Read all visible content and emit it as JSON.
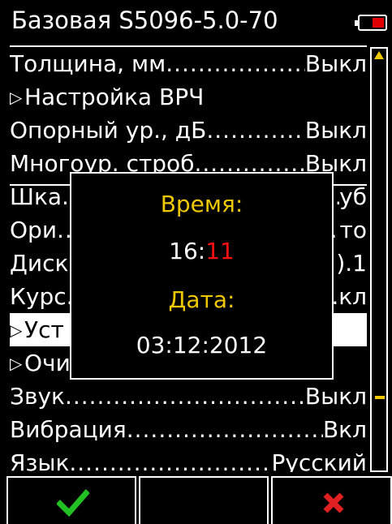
{
  "header": {
    "title": "Базовая S5096-5.0-70",
    "battery_icon": "battery-low-icon"
  },
  "menu": {
    "items": [
      {
        "label": "Толщина, мм",
        "value": "Выкл",
        "type": "value"
      },
      {
        "label": "Настройка ВРЧ",
        "value": "",
        "type": "submenu"
      },
      {
        "label": "Опорный ур., дБ",
        "value": "Выкл",
        "type": "value"
      },
      {
        "label": "Многоур. строб",
        "value": "Выкл",
        "type": "value"
      },
      {
        "label": "Шка",
        "value": "уб",
        "type": "value"
      },
      {
        "label": "Ори",
        "value": "то",
        "type": "value"
      },
      {
        "label": "Диск",
        "value": ").1",
        "type": "value"
      },
      {
        "label": "Курс",
        "value": "кл",
        "type": "value"
      },
      {
        "label": "Уст",
        "value": "",
        "type": "submenu",
        "selected": true
      },
      {
        "label": "Очи",
        "value": "",
        "type": "submenu"
      },
      {
        "label": "Звук",
        "value": "Выкл",
        "type": "value"
      },
      {
        "label": "Вибрация",
        "value": "Вкл",
        "type": "value"
      },
      {
        "label": "Язык",
        "value": "Русский",
        "type": "value"
      }
    ]
  },
  "dialog": {
    "time_label": "Время:",
    "time_hours": "16:",
    "time_minutes": "11",
    "date_label": "Дата:",
    "date_value": "03:12:2012"
  },
  "softkeys": {
    "ok_icon": "checkmark-icon",
    "middle": "",
    "cancel_icon": "cross-icon"
  },
  "colors": {
    "accent": "#f0c800",
    "highlight": "#ff1010",
    "ok": "#22c022",
    "cancel": "#e02020"
  }
}
